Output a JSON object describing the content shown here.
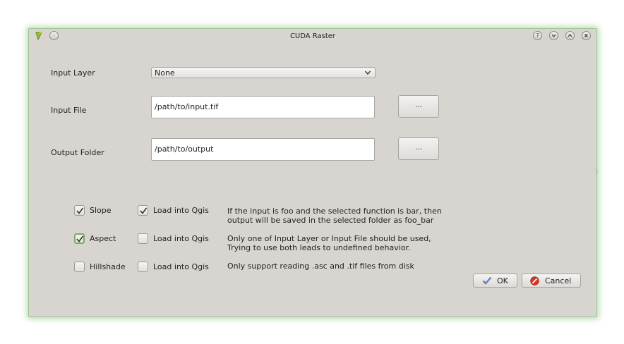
{
  "window": {
    "title": "CUDA Raster",
    "buttons": [
      "help",
      "minimize",
      "maximize",
      "close"
    ]
  },
  "form": {
    "input_layer": {
      "label": "Input Layer",
      "selected": "None"
    },
    "input_file": {
      "label": "Input File",
      "value": "/path/to/input.tif",
      "browse_label": "..."
    },
    "output_folder": {
      "label": "Output Folder",
      "value": "/path/to/output",
      "browse_label": "..."
    }
  },
  "functions": [
    {
      "label": "Slope",
      "checked": true,
      "load_label": "Load into Qgis",
      "load_checked": true,
      "desc1": "If the input is foo and the selected function is bar, then",
      "desc2": "output will be saved in the selected folder as foo_bar"
    },
    {
      "label": "Aspect",
      "checked": true,
      "load_label": "Load into Qgis",
      "load_checked": false,
      "desc1": "Only one of Input Layer or Input File should be used,",
      "desc2": "Trying to use both leads to undefined behavior."
    },
    {
      "label": "Hillshade",
      "checked": false,
      "load_label": "Load into Qgis",
      "load_checked": false,
      "desc1": "Only support reading .asc and .tif files from disk",
      "desc2": ""
    }
  ],
  "actions": {
    "ok_label": "OK",
    "cancel_label": "Cancel"
  }
}
